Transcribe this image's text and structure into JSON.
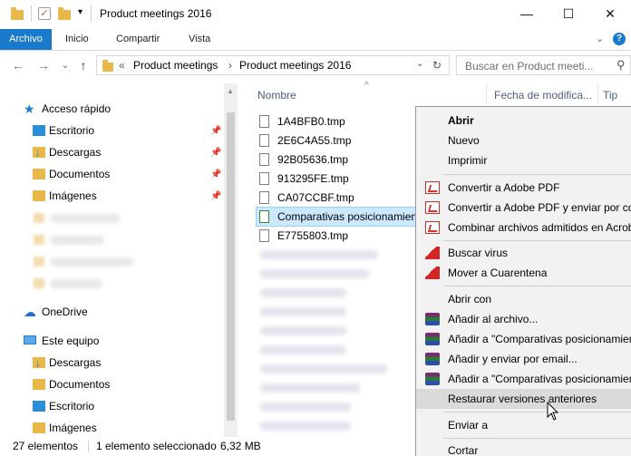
{
  "window": {
    "title": "Product meetings 2016",
    "minimize": "—",
    "maximize": "☐",
    "close": "✕"
  },
  "ribbon": {
    "tabs": [
      "Archivo",
      "Inicio",
      "Compartir",
      "Vista"
    ]
  },
  "address": {
    "back": "←",
    "forward": "→",
    "recent": "⌄",
    "up": "↑",
    "overflow": "«",
    "crumbs": [
      "Product meetings",
      "Product meetings 2016"
    ],
    "sep": "›",
    "refresh": "↻",
    "search_placeholder": "Buscar en Product meeti..."
  },
  "nav": {
    "quick_access": "Acceso rápido",
    "pinned": [
      {
        "label": "Escritorio",
        "icon": "desktop-icon"
      },
      {
        "label": "Descargas",
        "icon": "download-icon"
      },
      {
        "label": "Documentos",
        "icon": "documents-icon"
      },
      {
        "label": "Imágenes",
        "icon": "pictures-icon"
      }
    ],
    "onedrive": "OneDrive",
    "this_pc": "Este equipo",
    "pc_items": [
      {
        "label": "Descargas",
        "icon": "download-icon"
      },
      {
        "label": "Documentos",
        "icon": "documents-icon"
      },
      {
        "label": "Escritorio",
        "icon": "desktop-icon"
      },
      {
        "label": "Imágenes",
        "icon": "pictures-icon"
      }
    ]
  },
  "filelist": {
    "columns": [
      "Nombre",
      "Fecha de modifica...",
      "Tip"
    ],
    "files": [
      "1A4BFB0.tmp",
      "2E6C4A55.tmp",
      "92B05636.tmp",
      "913295FE.tmp",
      "CA07CCBF.tmp"
    ],
    "selected": "Comparativas posicionamien",
    "after_selected": "E7755803.tmp"
  },
  "status": {
    "count": "27 elementos",
    "selection": "1 elemento seleccionado",
    "size": "6,32 MB"
  },
  "context_menu": {
    "group1": [
      "Abrir",
      "Nuevo",
      "Imprimir"
    ],
    "pdf": [
      "Convertir a Adobe PDF",
      "Convertir a Adobe PDF y enviar por cor",
      "Combinar archivos admitidos en Acrob"
    ],
    "antivirus": [
      "Buscar virus",
      "Mover a Cuarentena"
    ],
    "open_with": "Abrir con",
    "rar": [
      "Añadir al archivo...",
      "Añadir a \"Comparativas posicionamien",
      "Añadir y enviar por email...",
      "Añadir a \"Comparativas posicionamien"
    ],
    "restore": "Restaurar versiones anteriores",
    "send_to": "Enviar a",
    "cut": "Cortar"
  }
}
